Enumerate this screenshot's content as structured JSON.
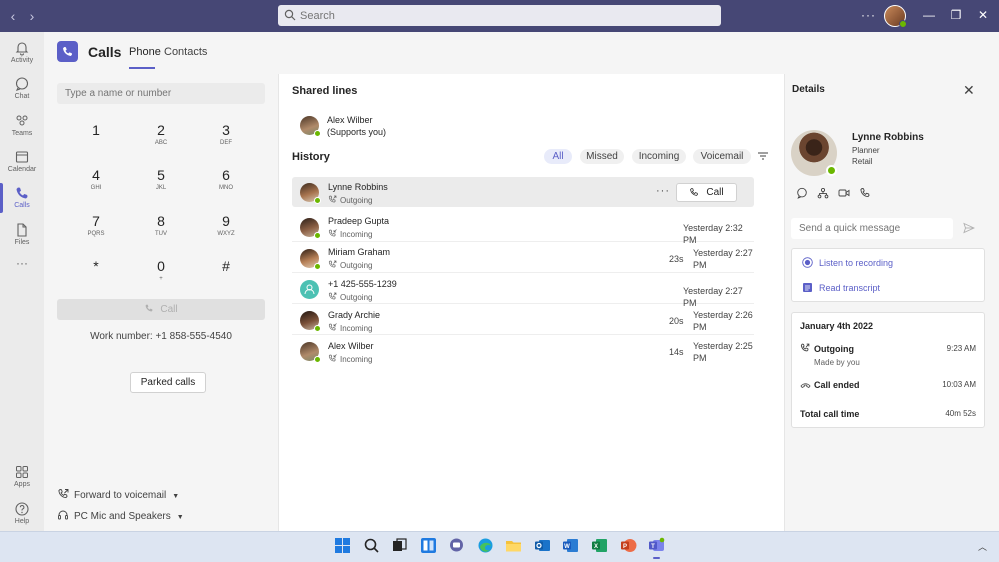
{
  "titlebar": {
    "search_placeholder": "Search",
    "more_label": "···"
  },
  "rail": {
    "items": [
      {
        "label": "Activity",
        "icon": "bell-icon"
      },
      {
        "label": "Chat",
        "icon": "chat-icon"
      },
      {
        "label": "Teams",
        "icon": "teams-icon"
      },
      {
        "label": "Calendar",
        "icon": "calendar-icon"
      },
      {
        "label": "Calls",
        "icon": "phone-icon",
        "active": true
      },
      {
        "label": "Files",
        "icon": "file-icon"
      },
      {
        "label": "···",
        "icon": "more-icon"
      },
      {
        "label": "Apps",
        "icon": "apps-icon"
      },
      {
        "label": "Help",
        "icon": "help-icon"
      }
    ]
  },
  "header": {
    "title": "Calls",
    "tabs": [
      {
        "label": "Phone",
        "active": true
      },
      {
        "label": "Contacts",
        "active": false
      }
    ]
  },
  "dialpad": {
    "input_placeholder": "Type a name or number",
    "keys": [
      {
        "digit": "1",
        "letters": ""
      },
      {
        "digit": "2",
        "letters": "ABC"
      },
      {
        "digit": "3",
        "letters": "DEF"
      },
      {
        "digit": "4",
        "letters": "GHI"
      },
      {
        "digit": "5",
        "letters": "JKL"
      },
      {
        "digit": "6",
        "letters": "MNO"
      },
      {
        "digit": "7",
        "letters": "PQRS"
      },
      {
        "digit": "8",
        "letters": "TUV"
      },
      {
        "digit": "9",
        "letters": "WXYZ"
      },
      {
        "digit": "*",
        "letters": ""
      },
      {
        "digit": "0",
        "letters": "+"
      },
      {
        "digit": "#",
        "letters": ""
      }
    ],
    "call_label": "Call",
    "work_number": "Work number: +1 858-555-4540",
    "parked_calls_label": "Parked calls",
    "forward_label": "Forward to voicemail",
    "device_label": "PC Mic and Speakers"
  },
  "shared_lines": {
    "title": "Shared lines",
    "entries": [
      {
        "name": "Alex Wilber",
        "note": "(Supports you)"
      }
    ]
  },
  "history": {
    "title": "History",
    "filters": [
      {
        "label": "All",
        "active": true
      },
      {
        "label": "Missed",
        "active": false
      },
      {
        "label": "Incoming",
        "active": false
      },
      {
        "label": "Voicemail",
        "active": false
      }
    ],
    "rows": [
      {
        "name": "Lynne Robbins",
        "direction": "Outgoing",
        "duration": "",
        "when": "",
        "selected": true,
        "call_label": "Call",
        "more": "···"
      },
      {
        "name": "Pradeep Gupta",
        "direction": "Incoming",
        "duration": "",
        "when": "Yesterday 2:32 PM"
      },
      {
        "name": "Miriam Graham",
        "direction": "Outgoing",
        "duration": "23s",
        "when_line1": "Yesterday 2:27",
        "when_line2": "PM"
      },
      {
        "name": "+1 425-555-1239",
        "direction": "Outgoing",
        "duration": "",
        "when": "Yesterday 2:27 PM"
      },
      {
        "name": "Grady Archie",
        "direction": "Incoming",
        "duration": "20s",
        "when_line1": "Yesterday 2:26",
        "when_line2": "PM"
      },
      {
        "name": "Alex Wilber",
        "direction": "Incoming",
        "duration": "14s",
        "when_line1": "Yesterday 2:25",
        "when_line2": "PM"
      }
    ]
  },
  "details": {
    "title": "Details",
    "close_icon": "close-icon",
    "person": {
      "name": "Lynne Robbins",
      "title": "Planner",
      "department": "Retail"
    },
    "quick_message_placeholder": "Send a quick message",
    "links": [
      {
        "label": "Listen to recording",
        "icon": "record-icon"
      },
      {
        "label": "Read transcript",
        "icon": "transcript-icon"
      }
    ],
    "summary": {
      "date": "January 4th 2022",
      "outgoing_label": "Outgoing",
      "outgoing_time": "9:23 AM",
      "made_by": "Made by you",
      "ended_label": "Call ended",
      "ended_time": "10:03 AM",
      "total_label": "Total call time",
      "total_value": "40m 52s"
    }
  },
  "taskbar": {
    "apps": [
      "windows-start-icon",
      "search-icon",
      "task-view-icon",
      "widgets-icon",
      "teams-chat-icon",
      "edge-icon",
      "file-explorer-icon",
      "outlook-icon",
      "word-icon",
      "excel-icon",
      "powerpoint-icon",
      "teams-icon"
    ]
  },
  "colors": {
    "titlebar": "#464775",
    "accent": "#5b5fc7",
    "presence_available": "#6bb700"
  }
}
